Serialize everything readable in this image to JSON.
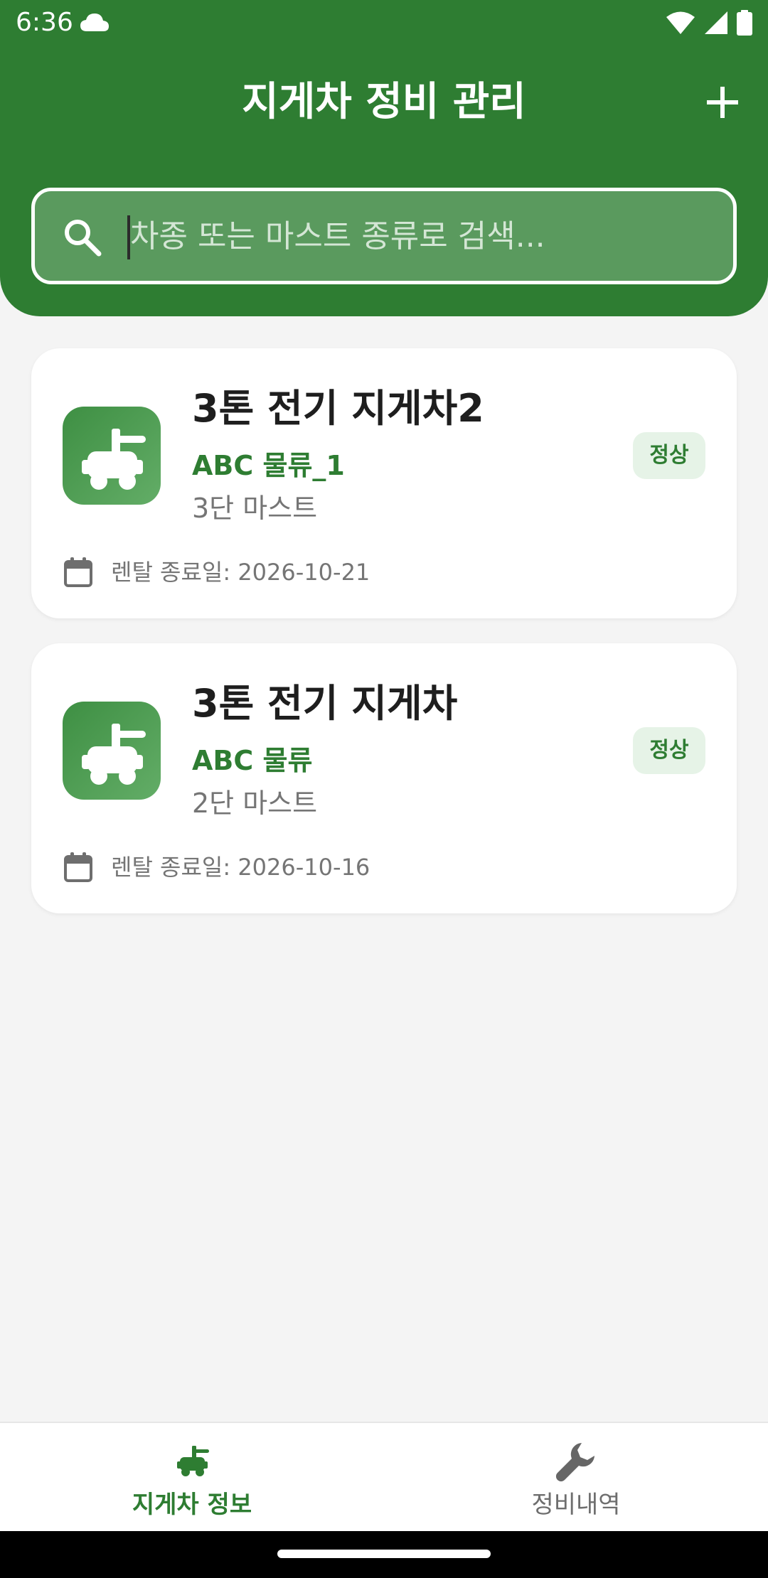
{
  "colors": {
    "primary": "#2e7d32",
    "background": "#f4f4f4",
    "card": "#ffffff",
    "badge_bg": "#e6f3e7",
    "muted_text": "#757575"
  },
  "status_bar": {
    "time": "6:36",
    "icons": [
      "cloud-icon",
      "wifi-icon",
      "cellular-signal-icon",
      "battery-icon"
    ]
  },
  "header": {
    "title": "지게차 정비 관리",
    "add_icon": "plus-icon"
  },
  "search": {
    "placeholder": "차종 또는 마스트 종류로 검색...",
    "value": "",
    "icon": "search-icon"
  },
  "forklifts": [
    {
      "icon": "forklift-icon",
      "name": "3톤 전기 지게차2",
      "company": "ABC 물류_1",
      "mast": "3단 마스트",
      "status": "정상",
      "rental_end": "렌탈 종료일: 2026-10-21"
    },
    {
      "icon": "forklift-icon",
      "name": "3톤 전기 지게차",
      "company": "ABC 물류",
      "mast": "2단 마스트",
      "status": "정상",
      "rental_end": "렌탈 종료일: 2026-10-16"
    }
  ],
  "bottom_nav": {
    "items": [
      {
        "label": "지게차 정보",
        "icon": "forklift-icon",
        "active": true
      },
      {
        "label": "정비내역",
        "icon": "wrench-icon",
        "active": false
      }
    ]
  }
}
